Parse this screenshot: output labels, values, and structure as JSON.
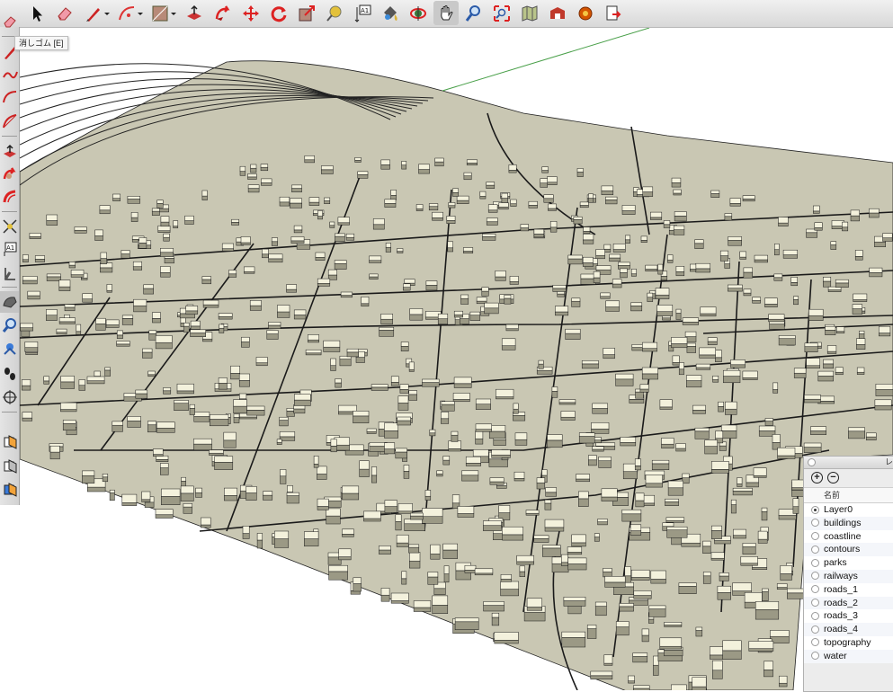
{
  "tooltip": "消しゴム [E]",
  "toolbar": {
    "items": [
      {
        "icon": "select-arrow-icon"
      },
      {
        "icon": "eraser-icon"
      },
      {
        "icon": "pencil-line-icon"
      },
      {
        "icon": "arc-icon"
      },
      {
        "icon": "shape-rectangle-icon"
      },
      {
        "icon": "push-pull-icon"
      },
      {
        "icon": "follow-me-icon"
      },
      {
        "icon": "move-icon"
      },
      {
        "icon": "rotate-icon"
      },
      {
        "icon": "scale-icon"
      },
      {
        "icon": "tape-measure-icon"
      },
      {
        "icon": "dimension-text-icon"
      },
      {
        "icon": "paint-bucket-icon"
      },
      {
        "icon": "orbit-icon"
      },
      {
        "icon": "pan-hand-icon"
      },
      {
        "icon": "zoom-icon"
      },
      {
        "icon": "zoom-extents-icon"
      },
      {
        "icon": "add-location-icon"
      },
      {
        "icon": "3d-warehouse-icon"
      },
      {
        "icon": "extension-warehouse-icon"
      },
      {
        "icon": "send-to-layout-icon"
      }
    ]
  },
  "left_toolbar": {
    "items": [
      {
        "icon": "eraser-icon"
      },
      {
        "icon": "line-icon"
      },
      {
        "icon": "freehand-icon"
      },
      {
        "icon": "arc-icon"
      },
      {
        "icon": "pie-icon"
      },
      {
        "icon": "push-pull-icon"
      },
      {
        "icon": "follow-me-icon"
      },
      {
        "icon": "offset-icon"
      },
      {
        "icon": "tape-measure-icon"
      },
      {
        "icon": "text-icon"
      },
      {
        "icon": "axes-icon"
      },
      {
        "icon": "orbit-icon"
      },
      {
        "icon": "zoom-icon"
      },
      {
        "icon": "look-around-icon"
      },
      {
        "icon": "walk-icon"
      },
      {
        "icon": "position-camera-icon"
      },
      {
        "icon": "section-plane-icon"
      },
      {
        "icon": "display-section-icon"
      },
      {
        "icon": "section-fill-icon"
      }
    ]
  },
  "layers_panel": {
    "title": "レ",
    "add_label": "+",
    "remove_label": "−",
    "column_name": "名前",
    "active_layer": "Layer0",
    "layers": [
      "Layer0",
      "buildings",
      "coastline",
      "contours",
      "parks",
      "railways",
      "roads_1",
      "roads_2",
      "roads_3",
      "roads_4",
      "topography",
      "water"
    ]
  },
  "colors": {
    "terrain": "#c9c7b3",
    "building_top": "#f3f1dc",
    "building_side": "#9b9985",
    "line": "#1a1a1a",
    "axis_green": "#4aa04a"
  }
}
